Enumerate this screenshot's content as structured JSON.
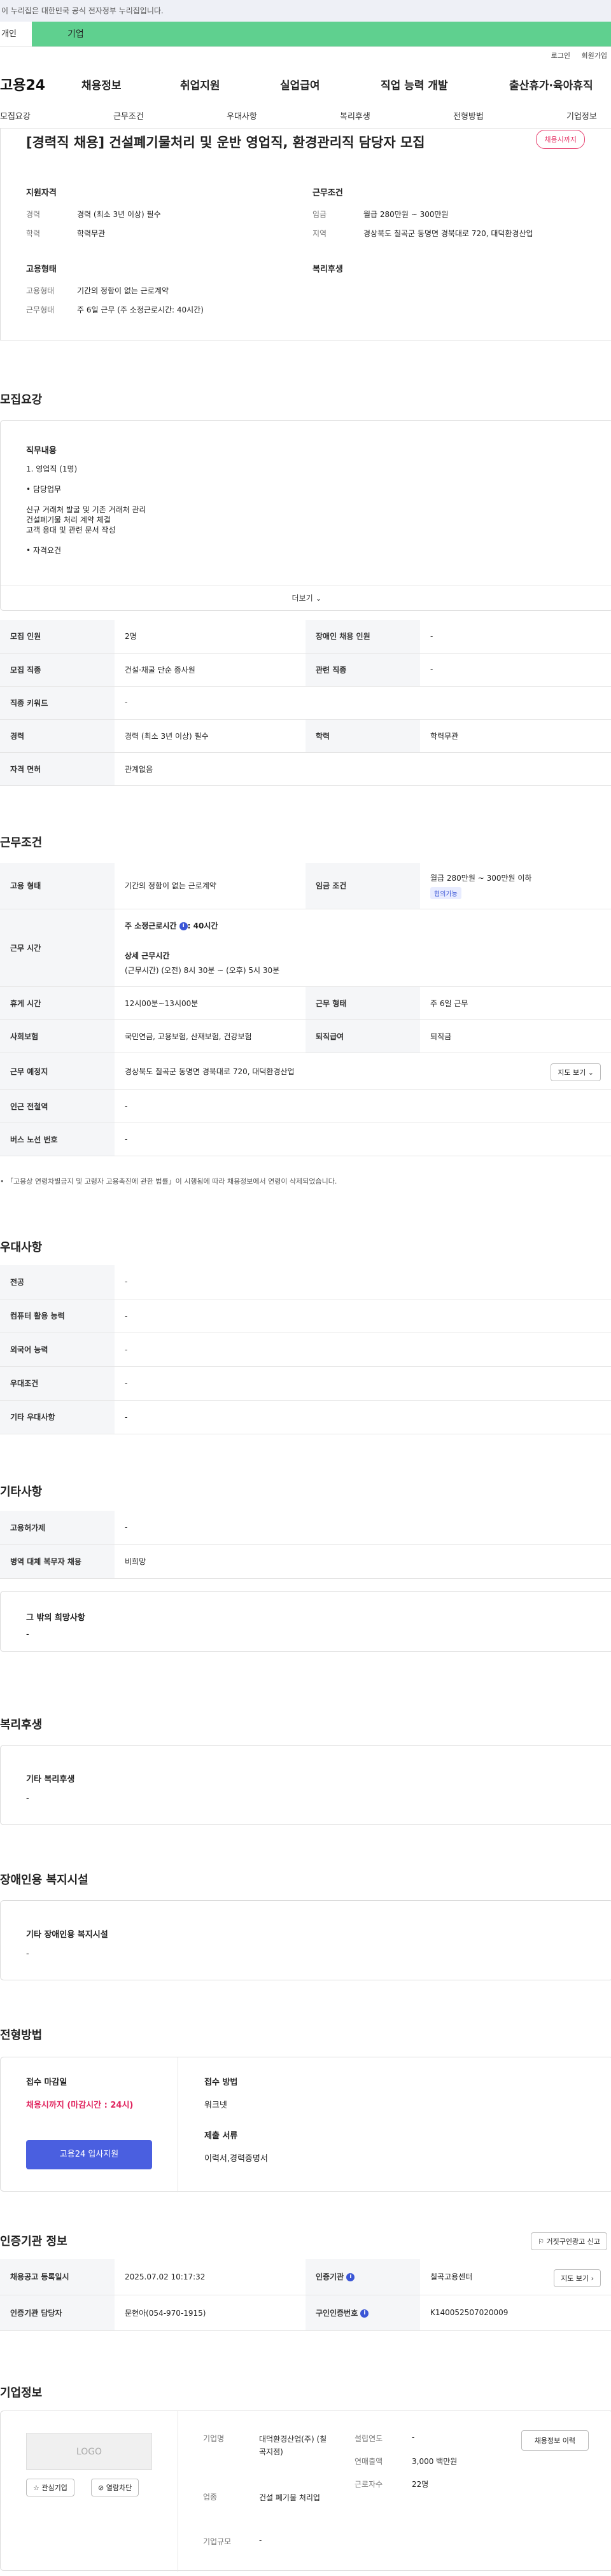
{
  "notice": "이 누리집은 대한민국 공식 전자정부 누리집입니다.",
  "tabs": {
    "individual": "개인",
    "company": "기업"
  },
  "util": {
    "login": "로그인",
    "join": "회원가입"
  },
  "gnb": {
    "logo": "고용24",
    "menu": [
      "채용정보",
      "취업지원",
      "실업급여",
      "직업 능력 개발",
      "출산휴가·육아휴직"
    ]
  },
  "subnav": [
    "모집요강",
    "근무조건",
    "우대사항",
    "복리후생",
    "전형방법",
    "기업정보"
  ],
  "job": {
    "title": "[경력직 채용] 건설폐기물처리 및 운반 영업직, 환경관리직 담당자 모집",
    "status": "채용시까지",
    "qualification": {
      "heading": "지원자격",
      "career_label": "경력",
      "career": "경력 (최소 3년 이상) 필수",
      "edu_label": "학력",
      "edu": "학력무관"
    },
    "conditions": {
      "heading": "근무조건",
      "wage_label": "임금",
      "wage": "월급 280만원 ~ 300만원",
      "area_label": "지역",
      "area": "경상북도 칠곡군 동명면 경북대로 720, 대덕환경산업"
    },
    "work": {
      "heading": "고용형태",
      "type_label": "고용형태",
      "type": "기간의 정함이 없는 근로계약",
      "form_label": "근무형태",
      "form": "주 6일 근무 (주 소정근로시간: 40시간)"
    },
    "welfare": {
      "heading": "복리후생"
    }
  },
  "recruit": {
    "title": "모집요강",
    "duty_heading": "직무내용",
    "duty_lines": [
      "1. 영업직 (1명)",
      "",
      "• 담당업무",
      "",
      "신규 거래처 발굴 및 기존 거래처 관리",
      "건설폐기물 처리 계약 체결",
      "고객 응대 및 관련 문서 작성",
      "",
      "• 자격요건"
    ],
    "more": "더보기",
    "rows": [
      {
        "k1": "모집 인원",
        "v1": "2명",
        "k2": "장애인 채용 인원",
        "v2": "-"
      },
      {
        "k1": "모집 직종",
        "v1": "건설·채굴 단순 종사원",
        "k2": "관련 직종",
        "v2": "-"
      },
      {
        "k1": "직종 키워드",
        "v1": "-"
      },
      {
        "k1": "경력",
        "v1": "경력 (최소 3년 이상) 필수",
        "k2": "학력",
        "v2": "학력무관"
      },
      {
        "k1": "자격 면허",
        "v1": "관계없음"
      }
    ]
  },
  "cond": {
    "title": "근무조건",
    "employ_label": "고용 형태",
    "employ": "기간의 정함이 없는 근로계약",
    "wage_label": "임금 조건",
    "wage": "월급 280만원 ~ 300만원 이하",
    "wage_tag": "협의가능",
    "hours_label": "근무 시간",
    "hours_main": "주 소정근로시간",
    "hours_val": ": 40시간",
    "hours_detail_head": "상세 근무시간",
    "hours_detail": "(근무시간) (오전) 8시 30분 ~ (오후) 5시 30분",
    "break_label": "휴게 시간",
    "break": "12시00분~13시00분",
    "form_label": "근무 형태",
    "form": "주 6일 근무",
    "ins_label": "사회보험",
    "ins": "국민연금, 고용보험, 산재보험, 건강보험",
    "ret_label": "퇴직급여",
    "ret": "퇴직금",
    "place_label": "근무 예정지",
    "place": "경상북도 칠곡군 동명면 경북대로 720, 대덕환경산업",
    "map_btn": "지도 보기",
    "subway_label": "인근 전철역",
    "subway": "-",
    "bus_label": "버스 노선 번호",
    "bus": "-",
    "footnote": "「고용상 연령차별금지 및 고령자 고용촉진에 관한 법률」이 시행됨에 따라 채용정보에서 연령이 삭제되었습니다."
  },
  "pref": {
    "title": "우대사항",
    "rows": [
      {
        "k": "전공",
        "v": "-"
      },
      {
        "k": "컴퓨터 활용 능력",
        "v": "-"
      },
      {
        "k": "외국어 능력",
        "v": "-"
      },
      {
        "k": "우대조건",
        "v": "-"
      },
      {
        "k": "기타 우대사항",
        "v": "-"
      }
    ]
  },
  "etc": {
    "title": "기타사항",
    "rows": [
      {
        "k": "고용허가제",
        "v": "-"
      },
      {
        "k": "병역 대체 복무자 채용",
        "v": "비희망"
      }
    ],
    "box_head": "그 밖의 희망사항",
    "box_val": "-"
  },
  "welfare": {
    "title": "복리후생",
    "box_head": "기타 복리후생",
    "box_val": "-"
  },
  "disab": {
    "title": "장애인용 복지시설",
    "box_head": "기타 장애인용 복지시설",
    "box_val": "-"
  },
  "process": {
    "title": "전형방법",
    "deadline_head": "접수 마감일",
    "deadline": "채용시까지 (마감시간 : 24시)",
    "apply_btn": "고용24 입사지원",
    "method_head": "접수 방법",
    "method": "워크넷",
    "docs_head": "제출 서류",
    "docs": "이력서,경력증명서"
  },
  "cert": {
    "title": "인증기관 정보",
    "report_btn": "거짓구인광고 신고",
    "reg_label": "채용공고 등록일시",
    "reg": "2025.07.02 10:17:32",
    "org_label": "인증기관",
    "org": "칠곡고용센터",
    "map_btn": "지도 보기",
    "mgr_label": "인증기관 담당자",
    "mgr": "문현아(054-970-1915)",
    "no_label": "구인인증번호",
    "no": "K140052507020009"
  },
  "company": {
    "title": "기업정보",
    "logo": "LOGO",
    "interest_btn": "관심기업",
    "block_btn": "열람차단",
    "name_label": "기업명",
    "name": "대덕환경산업(주) (칠곡지점)",
    "industry_label": "업종",
    "industry": "건설 폐기물 처리업",
    "scale_label": "기업규모",
    "scale": "-",
    "founded_label": "설립연도",
    "founded": "-",
    "sales_label": "연매출액",
    "sales": "3,000 백만원",
    "emp_label": "근로자수",
    "emp": "22명",
    "hist_btn": "채용정보 이력"
  }
}
